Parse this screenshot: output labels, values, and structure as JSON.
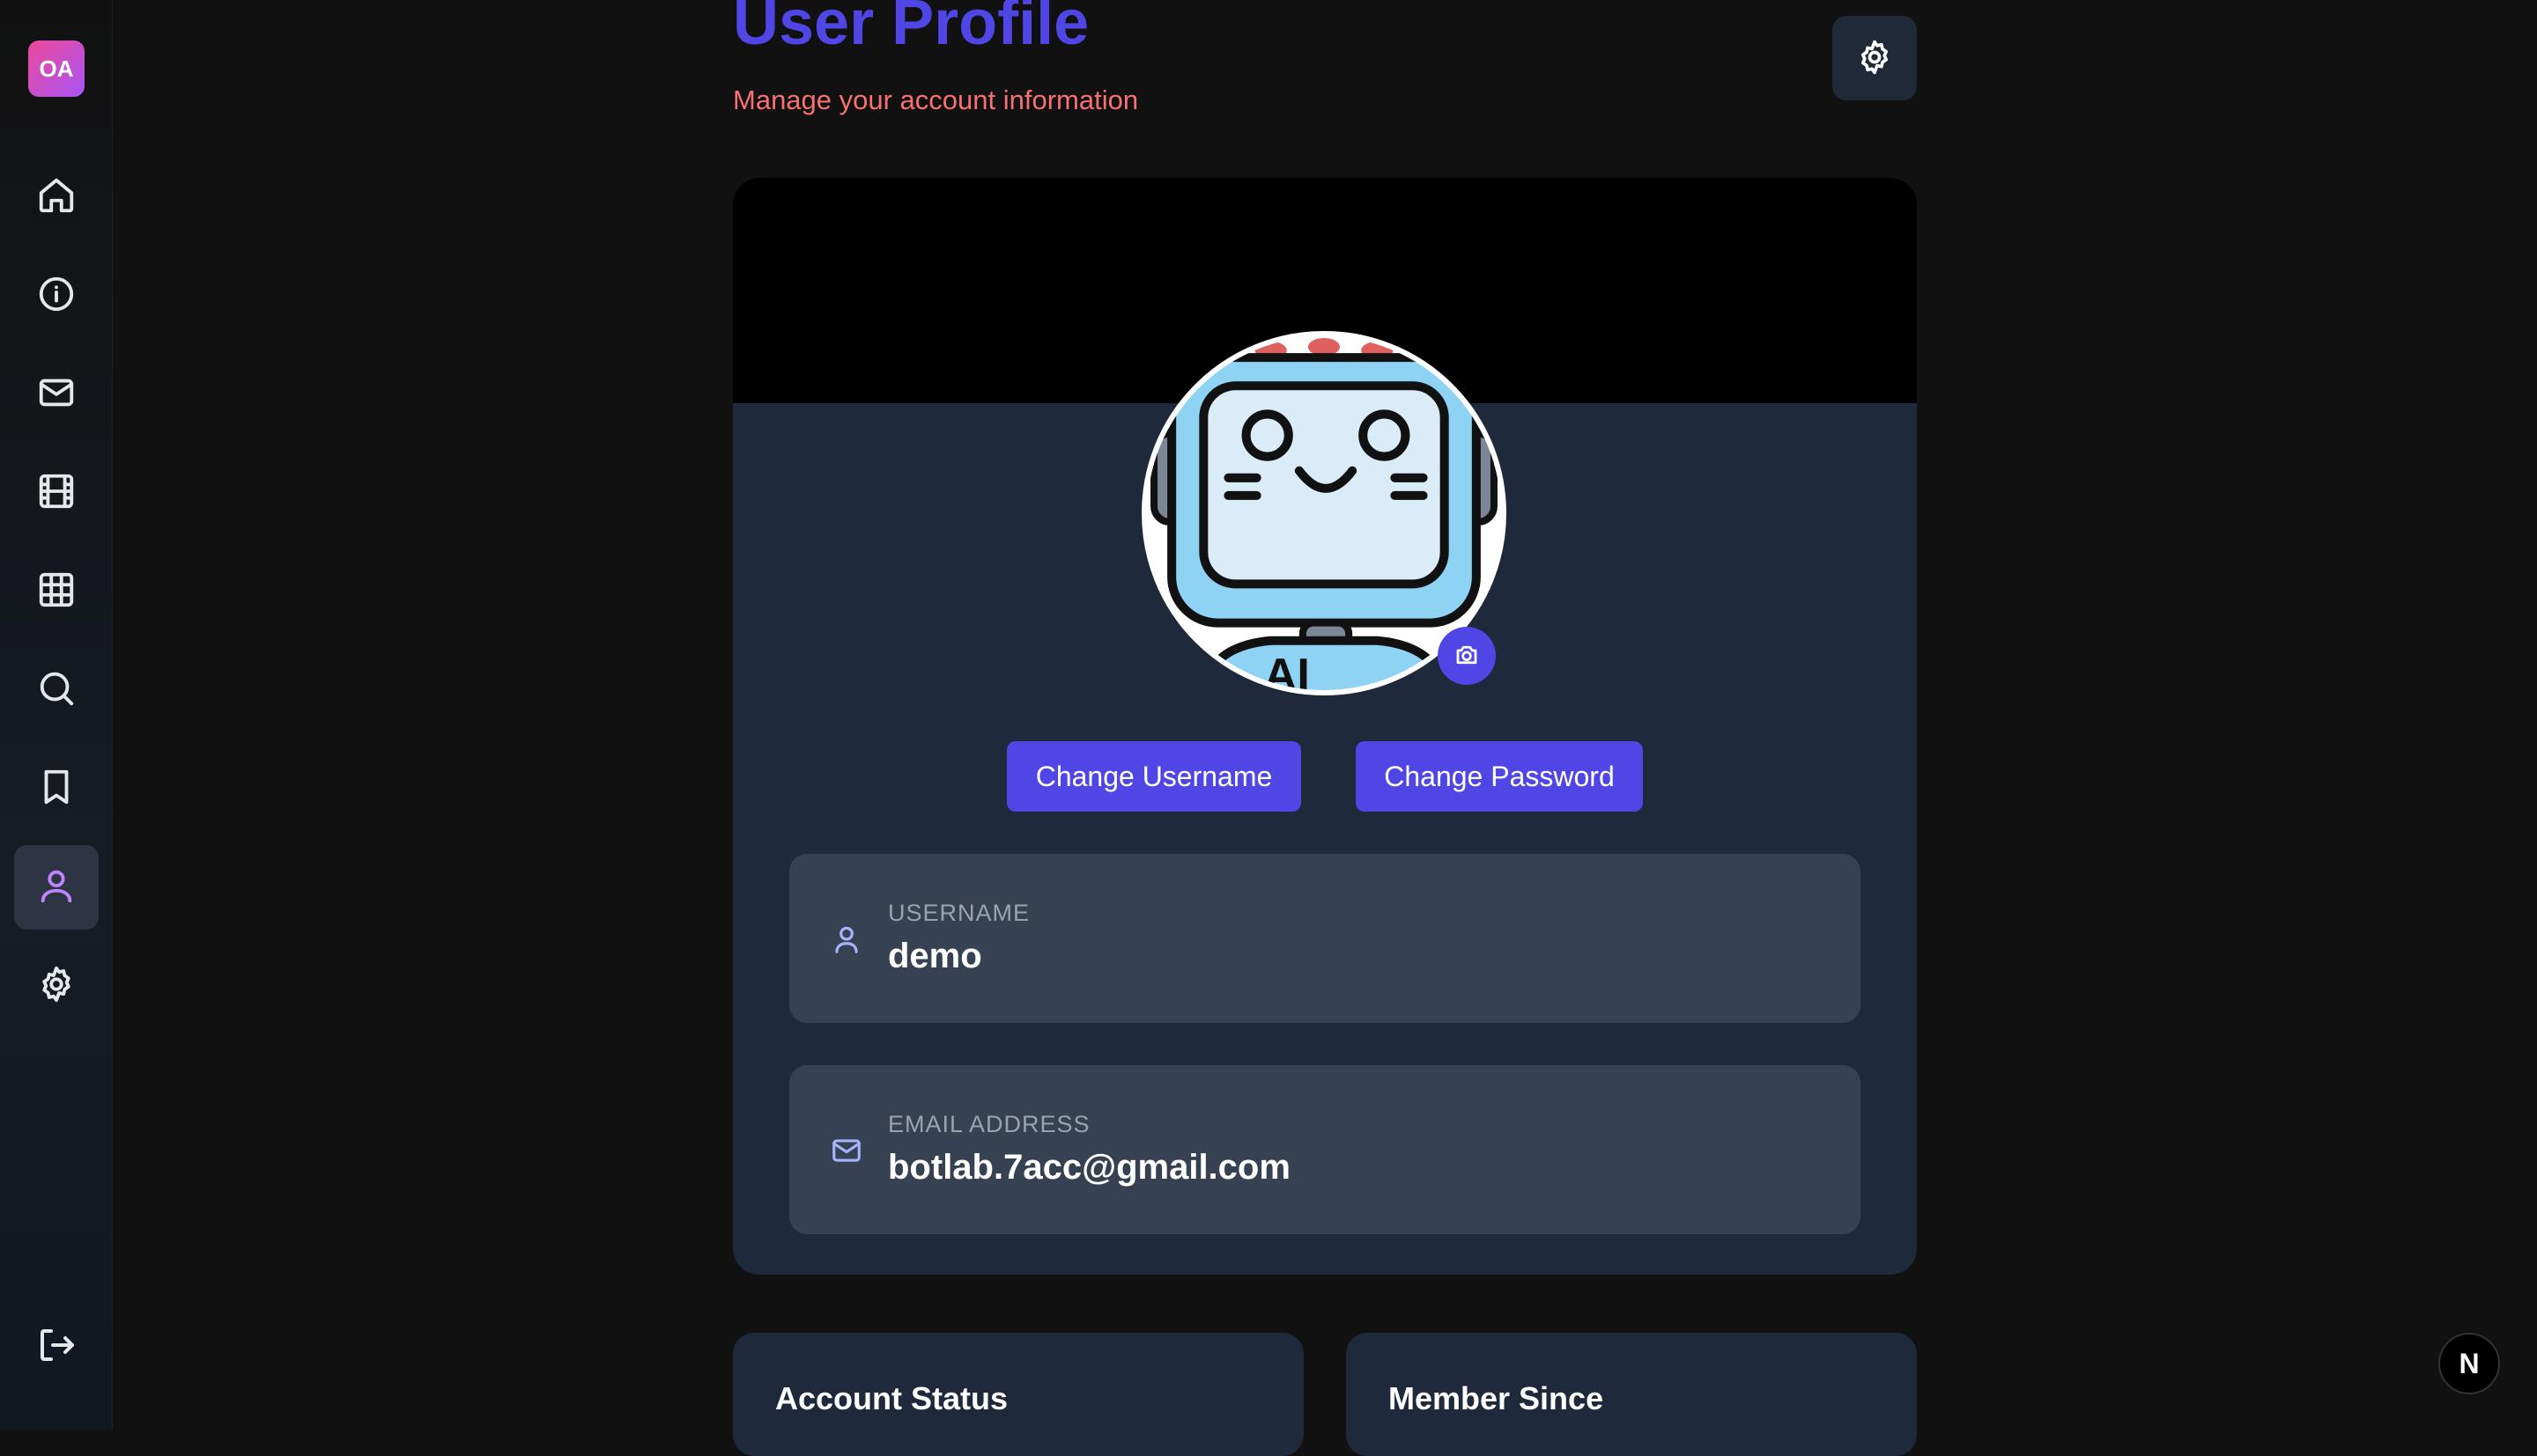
{
  "sidebar": {
    "logo_text": "OA",
    "items": [
      {
        "name": "home",
        "icon": "home-icon"
      },
      {
        "name": "about",
        "icon": "info-icon"
      },
      {
        "name": "messages",
        "icon": "mail-icon"
      },
      {
        "name": "movies",
        "icon": "film-icon"
      },
      {
        "name": "grid",
        "icon": "grid-icon"
      },
      {
        "name": "search",
        "icon": "search-icon"
      },
      {
        "name": "bookmarks",
        "icon": "bookmark-icon"
      },
      {
        "name": "profile",
        "icon": "user-icon",
        "active": true
      },
      {
        "name": "settings",
        "icon": "gear-icon"
      }
    ],
    "logout_icon": "logout-icon"
  },
  "header": {
    "title": "User Profile",
    "subtitle": "Manage your account information",
    "settings_icon": "gear-icon"
  },
  "profile": {
    "avatar_text": "AI",
    "camera_icon": "camera-icon",
    "change_username_label": "Change Username",
    "change_password_label": "Change Password",
    "username_label": "USERNAME",
    "username_value": "demo",
    "email_label": "EMAIL ADDRESS",
    "email_value": "botlab.7acc@gmail.com"
  },
  "cards": {
    "account_status_title": "Account Status",
    "member_since_title": "Member Since"
  },
  "badge": {
    "text": "N"
  },
  "colors": {
    "accent": "#4f46e5",
    "subtitle": "#f87171",
    "background": "#111111",
    "card": "#1e293b",
    "field": "#364152"
  }
}
